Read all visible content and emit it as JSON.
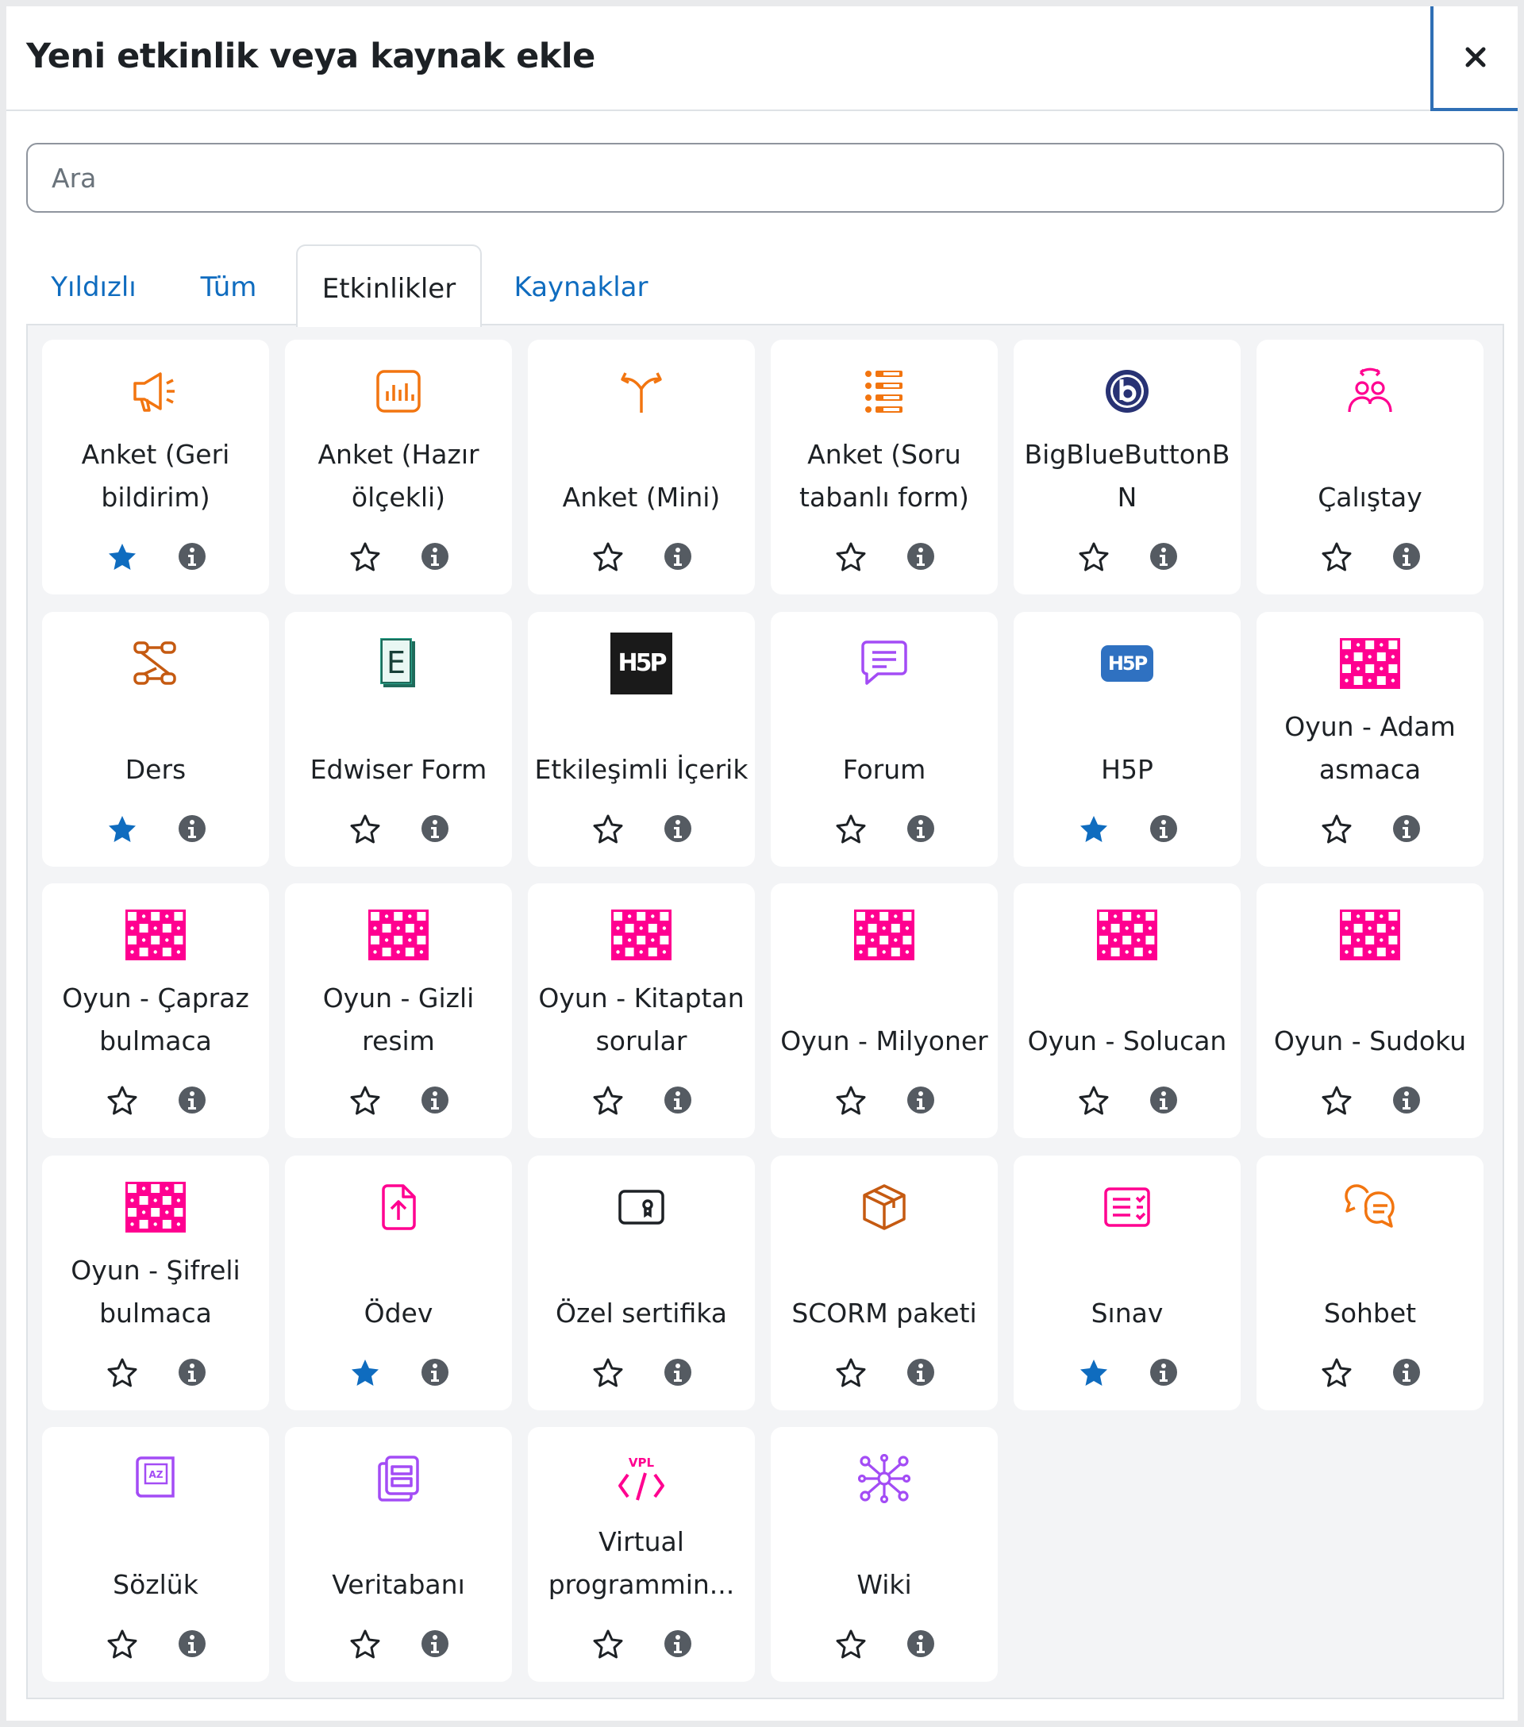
{
  "dialog": {
    "title": "Yeni etkinlik veya kaynak ekle",
    "close_label": "×"
  },
  "search": {
    "placeholder": "Ara"
  },
  "tabs": [
    {
      "label": "Yıldızlı",
      "active": false
    },
    {
      "label": "Tüm",
      "active": false
    },
    {
      "label": "Etkinlikler",
      "active": true
    },
    {
      "label": "Kaynaklar",
      "active": false
    }
  ],
  "colors": {
    "link": "#0f6cbf",
    "star_filled": "#0f6cbf",
    "info": "#555b62",
    "orange": "#f27510",
    "pink": "#ff0090",
    "purple": "#a34cf5",
    "brown": "#c55a11"
  },
  "activities": [
    {
      "name": "Anket (Geri bildirim)",
      "lines": [
        "Anket (Geri",
        "bildirim)"
      ],
      "icon": "megaphone-icon",
      "starred": true
    },
    {
      "name": "Anket (Hazır ölçekli)",
      "lines": [
        "Anket (Hazır",
        "ölçekli)"
      ],
      "icon": "bar-chart-icon",
      "starred": false
    },
    {
      "name": "Anket (Mini)",
      "lines": [
        "Anket (Mini)"
      ],
      "icon": "signpost-icon",
      "starred": false
    },
    {
      "name": "Anket (Soru tabanlı form)",
      "lines": [
        "Anket (Soru",
        "tabanlı form)"
      ],
      "icon": "list-icon",
      "starred": false
    },
    {
      "name": "BigBlueButtonBN",
      "lines": [
        "BigBlueButtonB",
        "N"
      ],
      "icon": "bigbluebutton-icon",
      "starred": false
    },
    {
      "name": "Çalıştay",
      "lines": [
        "Çalıştay"
      ],
      "icon": "workshop-icon",
      "starred": false
    },
    {
      "name": "Ders",
      "lines": [
        "Ders"
      ],
      "icon": "lesson-flow-icon",
      "starred": true
    },
    {
      "name": "Edwiser Form",
      "lines": [
        "Edwiser Form"
      ],
      "icon": "edwiser-icon",
      "starred": false
    },
    {
      "name": "Etkileşimli İçerik",
      "lines": [
        "Etkileşimli İçerik"
      ],
      "icon": "h5p-black-icon",
      "starred": false
    },
    {
      "name": "Forum",
      "lines": [
        "Forum"
      ],
      "icon": "forum-icon",
      "starred": false
    },
    {
      "name": "H5P",
      "lines": [
        "H5P"
      ],
      "icon": "h5p-blue-icon",
      "starred": true
    },
    {
      "name": "Oyun - Adam asmaca",
      "lines": [
        "Oyun - Adam",
        "asmaca"
      ],
      "icon": "game-grid-icon",
      "starred": false
    },
    {
      "name": "Oyun - Çapraz bulmaca",
      "lines": [
        "Oyun - Çapraz",
        "bulmaca"
      ],
      "icon": "game-grid-icon",
      "starred": false
    },
    {
      "name": "Oyun - Gizli resim",
      "lines": [
        "Oyun - Gizli",
        "resim"
      ],
      "icon": "game-grid-icon",
      "starred": false
    },
    {
      "name": "Oyun - Kitaptan sorular",
      "lines": [
        "Oyun - Kitaptan",
        "sorular"
      ],
      "icon": "game-grid-icon",
      "starred": false
    },
    {
      "name": "Oyun - Milyoner",
      "lines": [
        "Oyun - Milyoner"
      ],
      "icon": "game-grid-icon",
      "starred": false
    },
    {
      "name": "Oyun - Solucan",
      "lines": [
        "Oyun - Solucan"
      ],
      "icon": "game-grid-icon",
      "starred": false
    },
    {
      "name": "Oyun - Sudoku",
      "lines": [
        "Oyun - Sudoku"
      ],
      "icon": "game-grid-icon",
      "starred": false
    },
    {
      "name": "Oyun - Şifreli bulmaca",
      "lines": [
        "Oyun - Şifreli",
        "bulmaca"
      ],
      "icon": "game-grid-icon",
      "starred": false
    },
    {
      "name": "Ödev",
      "lines": [
        "Ödev"
      ],
      "icon": "assignment-upload-icon",
      "starred": true
    },
    {
      "name": "Özel sertifika",
      "lines": [
        "Özel sertifika"
      ],
      "icon": "certificate-icon",
      "starred": false
    },
    {
      "name": "SCORM paketi",
      "lines": [
        "SCORM paketi"
      ],
      "icon": "package-icon",
      "starred": false
    },
    {
      "name": "Sınav",
      "lines": [
        "Sınav"
      ],
      "icon": "quiz-icon",
      "starred": true
    },
    {
      "name": "Sohbet",
      "lines": [
        "Sohbet"
      ],
      "icon": "chat-icon",
      "starred": false
    },
    {
      "name": "Sözlük",
      "lines": [
        "Sözlük"
      ],
      "icon": "glossary-icon",
      "starred": false
    },
    {
      "name": "Veritabanı",
      "lines": [
        "Veritabanı"
      ],
      "icon": "database-icon",
      "starred": false
    },
    {
      "name": "Virtual programmin...",
      "lines": [
        "Virtual",
        "programmin..."
      ],
      "icon": "vpl-icon",
      "starred": false
    },
    {
      "name": "Wiki",
      "lines": [
        "Wiki"
      ],
      "icon": "wiki-icon",
      "starred": false
    }
  ]
}
